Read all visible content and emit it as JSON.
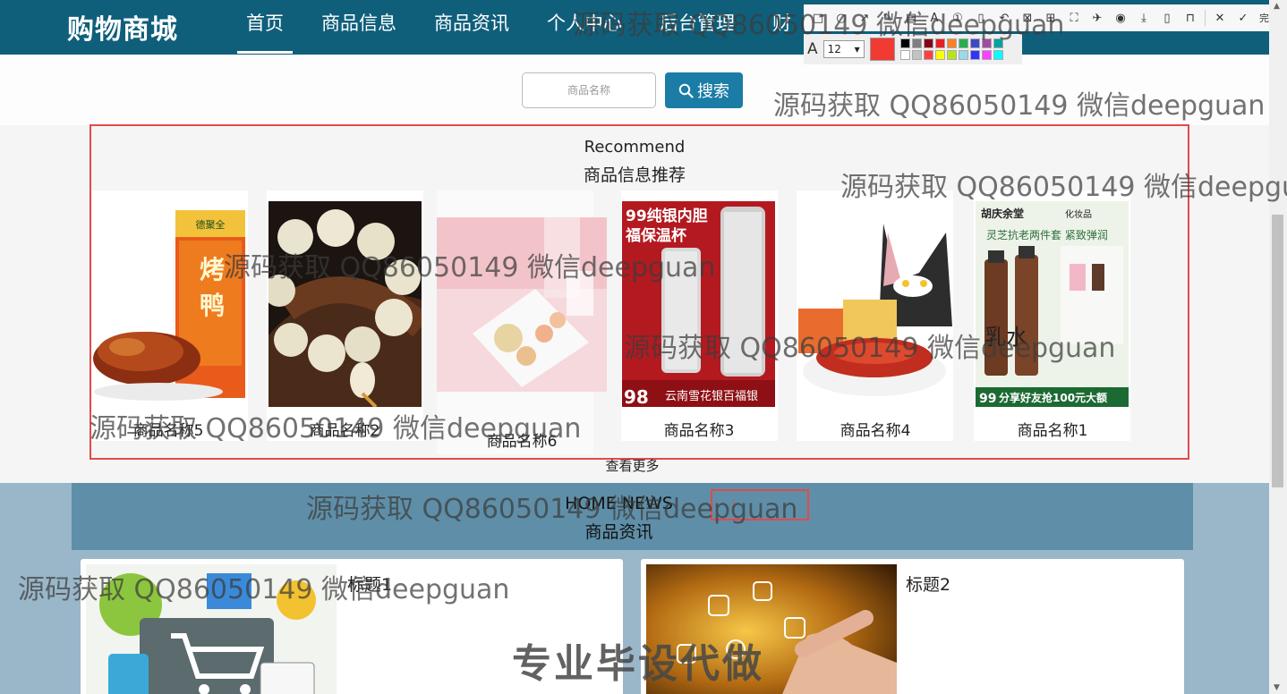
{
  "header": {
    "logo": "购物商城",
    "nav": [
      "首页",
      "商品信息",
      "商品资讯",
      "个人中心",
      "后台管理",
      "财"
    ]
  },
  "toolbar": {
    "done_label": "完成",
    "font_size": "12",
    "current_color": "#f03a32",
    "palette": [
      "#000000",
      "#7f7f7f",
      "#880015",
      "#ed1c24",
      "#ff7f27",
      "#22b14c",
      "#3f48cc",
      "#a349a4",
      "#00a2a2",
      "#ffffff",
      "#c3c3c3",
      "#ff4040",
      "#ffff00",
      "#b5e61d",
      "#99d9ea",
      "#3333ff",
      "#ff40ff",
      "#00ffff"
    ]
  },
  "search": {
    "placeholder": "商品名称",
    "button_label": "搜索"
  },
  "recommend": {
    "title_en": "Recommend",
    "title_cn": "商品信息推荐",
    "products": [
      {
        "name": "商品名称5"
      },
      {
        "name": "商品名称2"
      },
      {
        "name": "商品名称6"
      },
      {
        "name": "商品名称3"
      },
      {
        "name": "商品名称4"
      },
      {
        "name": "商品名称1"
      }
    ],
    "see_more": "查看更多"
  },
  "news": {
    "title_en": "HOME NEWS",
    "title_cn": "商品资讯",
    "items": [
      {
        "title": "标题1"
      },
      {
        "title": "标题2"
      }
    ]
  },
  "product_images": {
    "duck_box": "烤鸭",
    "duck_brand": "德聚全",
    "cup_banner": "99纯银内胆",
    "cup_banner2": "福保温杯",
    "cup_bottom": "云南雪花银百福银",
    "cup_price": "98",
    "cosmetic_brand": "胡庆余堂",
    "cosmetic_sub": "化妆品",
    "cosmetic_slogan": "灵芝抗老两件套 紧致弹润",
    "cosmetic_bottom": "分享好友抢100元大额",
    "cosmetic_char": "乳水",
    "cosmetic_price": "99"
  },
  "watermarks": {
    "text": "源码获取 QQ86050149 微信deepguan",
    "text_cut": "源码获取 QQ86050149 微信deepgu",
    "big": "专业毕设代做"
  }
}
